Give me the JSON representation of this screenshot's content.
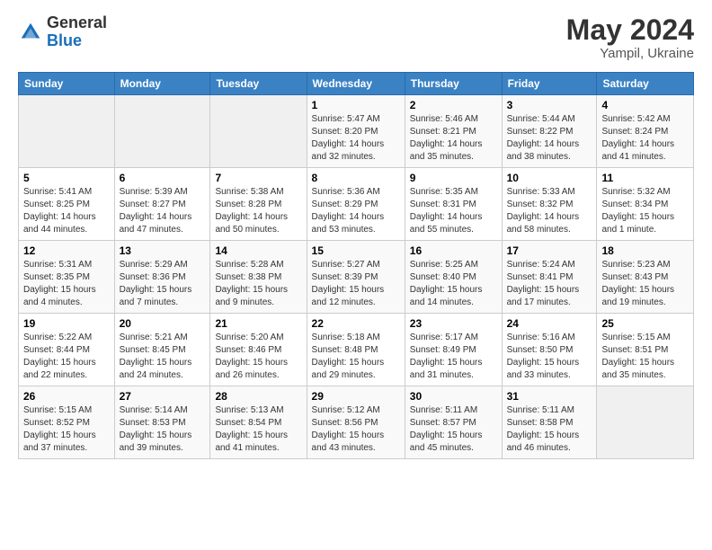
{
  "header": {
    "logo_general": "General",
    "logo_blue": "Blue",
    "month_year": "May 2024",
    "location": "Yampil, Ukraine"
  },
  "days_of_week": [
    "Sunday",
    "Monday",
    "Tuesday",
    "Wednesday",
    "Thursday",
    "Friday",
    "Saturday"
  ],
  "weeks": [
    [
      {
        "num": "",
        "info": ""
      },
      {
        "num": "",
        "info": ""
      },
      {
        "num": "",
        "info": ""
      },
      {
        "num": "1",
        "info": "Sunrise: 5:47 AM\nSunset: 8:20 PM\nDaylight: 14 hours\nand 32 minutes."
      },
      {
        "num": "2",
        "info": "Sunrise: 5:46 AM\nSunset: 8:21 PM\nDaylight: 14 hours\nand 35 minutes."
      },
      {
        "num": "3",
        "info": "Sunrise: 5:44 AM\nSunset: 8:22 PM\nDaylight: 14 hours\nand 38 minutes."
      },
      {
        "num": "4",
        "info": "Sunrise: 5:42 AM\nSunset: 8:24 PM\nDaylight: 14 hours\nand 41 minutes."
      }
    ],
    [
      {
        "num": "5",
        "info": "Sunrise: 5:41 AM\nSunset: 8:25 PM\nDaylight: 14 hours\nand 44 minutes."
      },
      {
        "num": "6",
        "info": "Sunrise: 5:39 AM\nSunset: 8:27 PM\nDaylight: 14 hours\nand 47 minutes."
      },
      {
        "num": "7",
        "info": "Sunrise: 5:38 AM\nSunset: 8:28 PM\nDaylight: 14 hours\nand 50 minutes."
      },
      {
        "num": "8",
        "info": "Sunrise: 5:36 AM\nSunset: 8:29 PM\nDaylight: 14 hours\nand 53 minutes."
      },
      {
        "num": "9",
        "info": "Sunrise: 5:35 AM\nSunset: 8:31 PM\nDaylight: 14 hours\nand 55 minutes."
      },
      {
        "num": "10",
        "info": "Sunrise: 5:33 AM\nSunset: 8:32 PM\nDaylight: 14 hours\nand 58 minutes."
      },
      {
        "num": "11",
        "info": "Sunrise: 5:32 AM\nSunset: 8:34 PM\nDaylight: 15 hours\nand 1 minute."
      }
    ],
    [
      {
        "num": "12",
        "info": "Sunrise: 5:31 AM\nSunset: 8:35 PM\nDaylight: 15 hours\nand 4 minutes."
      },
      {
        "num": "13",
        "info": "Sunrise: 5:29 AM\nSunset: 8:36 PM\nDaylight: 15 hours\nand 7 minutes."
      },
      {
        "num": "14",
        "info": "Sunrise: 5:28 AM\nSunset: 8:38 PM\nDaylight: 15 hours\nand 9 minutes."
      },
      {
        "num": "15",
        "info": "Sunrise: 5:27 AM\nSunset: 8:39 PM\nDaylight: 15 hours\nand 12 minutes."
      },
      {
        "num": "16",
        "info": "Sunrise: 5:25 AM\nSunset: 8:40 PM\nDaylight: 15 hours\nand 14 minutes."
      },
      {
        "num": "17",
        "info": "Sunrise: 5:24 AM\nSunset: 8:41 PM\nDaylight: 15 hours\nand 17 minutes."
      },
      {
        "num": "18",
        "info": "Sunrise: 5:23 AM\nSunset: 8:43 PM\nDaylight: 15 hours\nand 19 minutes."
      }
    ],
    [
      {
        "num": "19",
        "info": "Sunrise: 5:22 AM\nSunset: 8:44 PM\nDaylight: 15 hours\nand 22 minutes."
      },
      {
        "num": "20",
        "info": "Sunrise: 5:21 AM\nSunset: 8:45 PM\nDaylight: 15 hours\nand 24 minutes."
      },
      {
        "num": "21",
        "info": "Sunrise: 5:20 AM\nSunset: 8:46 PM\nDaylight: 15 hours\nand 26 minutes."
      },
      {
        "num": "22",
        "info": "Sunrise: 5:18 AM\nSunset: 8:48 PM\nDaylight: 15 hours\nand 29 minutes."
      },
      {
        "num": "23",
        "info": "Sunrise: 5:17 AM\nSunset: 8:49 PM\nDaylight: 15 hours\nand 31 minutes."
      },
      {
        "num": "24",
        "info": "Sunrise: 5:16 AM\nSunset: 8:50 PM\nDaylight: 15 hours\nand 33 minutes."
      },
      {
        "num": "25",
        "info": "Sunrise: 5:15 AM\nSunset: 8:51 PM\nDaylight: 15 hours\nand 35 minutes."
      }
    ],
    [
      {
        "num": "26",
        "info": "Sunrise: 5:15 AM\nSunset: 8:52 PM\nDaylight: 15 hours\nand 37 minutes."
      },
      {
        "num": "27",
        "info": "Sunrise: 5:14 AM\nSunset: 8:53 PM\nDaylight: 15 hours\nand 39 minutes."
      },
      {
        "num": "28",
        "info": "Sunrise: 5:13 AM\nSunset: 8:54 PM\nDaylight: 15 hours\nand 41 minutes."
      },
      {
        "num": "29",
        "info": "Sunrise: 5:12 AM\nSunset: 8:56 PM\nDaylight: 15 hours\nand 43 minutes."
      },
      {
        "num": "30",
        "info": "Sunrise: 5:11 AM\nSunset: 8:57 PM\nDaylight: 15 hours\nand 45 minutes."
      },
      {
        "num": "31",
        "info": "Sunrise: 5:11 AM\nSunset: 8:58 PM\nDaylight: 15 hours\nand 46 minutes."
      },
      {
        "num": "",
        "info": ""
      }
    ]
  ]
}
